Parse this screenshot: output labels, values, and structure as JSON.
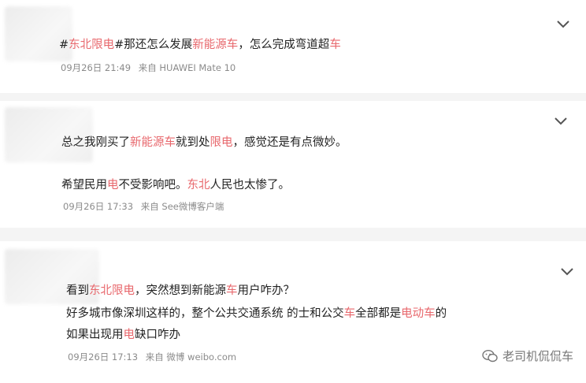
{
  "posts": [
    {
      "lines": [
        [
          {
            "t": "#",
            "h": false
          },
          {
            "t": "东北限电",
            "h": true
          },
          {
            "t": "#那还怎么发展",
            "h": false
          },
          {
            "t": "新能源车",
            "h": true
          },
          {
            "t": "，怎么完成弯道超",
            "h": false
          },
          {
            "t": "车",
            "h": true
          }
        ]
      ],
      "time": "09月26日 21:49",
      "source": "来自 HUAWEI Mate 10"
    },
    {
      "lines": [
        [
          {
            "t": "总之我刚买了",
            "h": false
          },
          {
            "t": "新能源车",
            "h": true
          },
          {
            "t": "就到处",
            "h": false
          },
          {
            "t": "限电",
            "h": true
          },
          {
            "t": "，感觉还是有点微妙。",
            "h": false
          }
        ],
        [
          {
            "t": "希望民用",
            "h": false
          },
          {
            "t": "电",
            "h": true
          },
          {
            "t": "不受影响吧。",
            "h": false
          },
          {
            "t": "东北",
            "h": true
          },
          {
            "t": "人民也太惨了。",
            "h": false
          }
        ]
      ],
      "time": "09月26日 17:33",
      "source": "来自 See微博客户端"
    },
    {
      "lines": [
        [
          {
            "t": "看到",
            "h": false
          },
          {
            "t": "东北限电",
            "h": true
          },
          {
            "t": "，突然想到新能源",
            "h": false
          },
          {
            "t": "车",
            "h": true
          },
          {
            "t": "用户咋办？",
            "h": false
          }
        ],
        [
          {
            "t": "好多城市像深圳这样的，整个公共交通系统 的士和公交",
            "h": false
          },
          {
            "t": "车",
            "h": true
          },
          {
            "t": "全部都是",
            "h": false
          },
          {
            "t": "电动车",
            "h": true
          },
          {
            "t": "的",
            "h": false
          }
        ],
        [
          {
            "t": "如果出现用",
            "h": false
          },
          {
            "t": "电",
            "h": true
          },
          {
            "t": "缺口咋办",
            "h": false
          }
        ]
      ],
      "time": "09月26日 17:13",
      "source": "来自 微博 weibo.com"
    }
  ],
  "watermark": {
    "text": "老司机侃侃车",
    "icon": "wechat-icon"
  },
  "colors": {
    "highlight": "#e8686d",
    "meta": "#8b8b8b",
    "background": "#f4f4f4"
  }
}
